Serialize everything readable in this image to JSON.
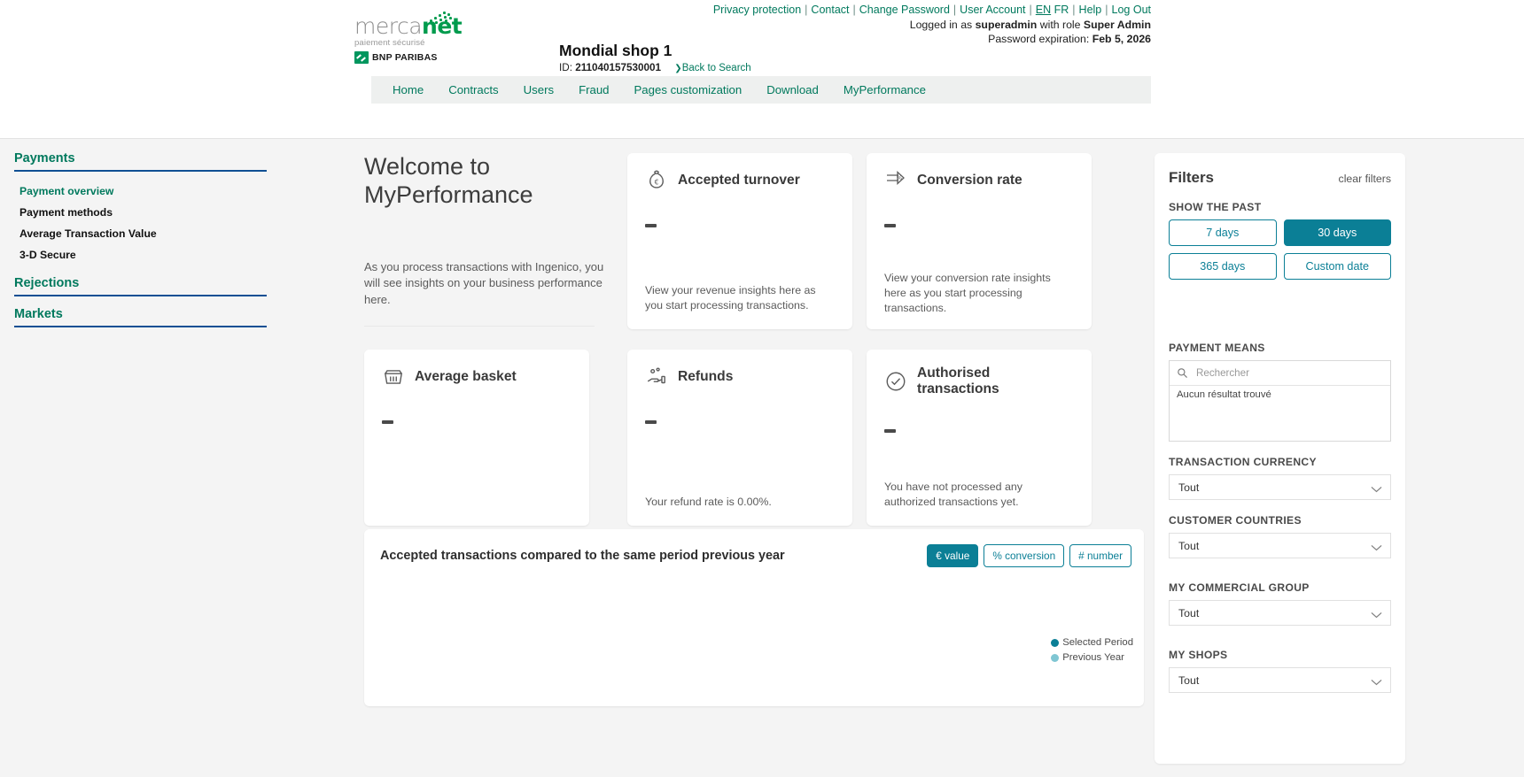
{
  "header": {
    "util_links": [
      "Privacy protection",
      "Contact",
      "Change Password",
      "User Account"
    ],
    "lang_en": "EN",
    "lang_fr": "FR",
    "help": "Help",
    "logout": "Log Out",
    "logged_in_prefix": "Logged in as ",
    "username": "superadmin",
    "role_prefix": " with role ",
    "role": "Super Admin",
    "password_expiration_label": "Password expiration: ",
    "password_expiration_value": "Feb 5, 2026",
    "logo_word_1": "merca",
    "logo_word_2": "net",
    "logo_tagline": "paiement sécurisé",
    "bank": "BNP PARIBAS",
    "shop_title": "Mondial shop 1",
    "shop_id_label": "ID: ",
    "shop_id_value": "211040157530001",
    "back_to_search": "Back to Search"
  },
  "nav": {
    "items": [
      "Home",
      "Contracts",
      "Users",
      "Fraud",
      "Pages customization",
      "Download",
      "MyPerformance"
    ]
  },
  "sidebar": {
    "groups": [
      {
        "title": "Payments",
        "items": [
          "Payment overview",
          "Payment methods",
          "Average Transaction Value",
          "3-D Secure"
        ]
      },
      {
        "title": "Rejections",
        "items": []
      },
      {
        "title": "Markets",
        "items": []
      }
    ]
  },
  "welcome": {
    "title_line1": "Welcome to",
    "title_line2": "MyPerformance",
    "body": "As you process transactions with Ingenico, you will see insights on your business performance here."
  },
  "kpis": [
    {
      "icon": "money-bag-icon",
      "title": "Accepted turnover",
      "value": "–",
      "note": "View your revenue insights here as you start processing transactions."
    },
    {
      "icon": "conversion-arrow-icon",
      "title": "Conversion rate",
      "value": "–",
      "note": "View your conversion rate insights here as you start processing transactions."
    },
    {
      "icon": "basket-icon",
      "title": "Average basket",
      "value": "–",
      "note": ""
    },
    {
      "icon": "refund-hand-icon",
      "title": "Refunds",
      "value": "–",
      "note": "Your refund rate is 0.00%."
    },
    {
      "icon": "check-circle-icon",
      "title": "Authorised transactions",
      "value": "–",
      "note": "You have not processed any authorized transactions yet."
    }
  ],
  "chart_card": {
    "title": "Accepted transactions compared to the same period previous year",
    "toggles": [
      {
        "label": "€ value",
        "active": true
      },
      {
        "label": "% conversion",
        "active": false
      },
      {
        "label": "# number",
        "active": false
      }
    ]
  },
  "chart_data": {
    "type": "bar",
    "title": "Accepted transactions compared to the same period previous year",
    "categories": [],
    "series": [
      {
        "name": "Selected Period",
        "values": [],
        "color": "#0b7f96"
      },
      {
        "name": "Previous Year",
        "values": [],
        "color": "#7fc6d3"
      }
    ],
    "xlabel": "",
    "ylabel": "",
    "legend_position": "bottom-right",
    "grid": false,
    "note": "No data plotted — chart area is empty"
  },
  "filters": {
    "title": "Filters",
    "clear": "clear filters",
    "show_past_label": "SHOW THE PAST",
    "range_buttons": [
      {
        "label": "7 days",
        "active": false
      },
      {
        "label": "30 days",
        "active": true
      },
      {
        "label": "365 days",
        "active": false
      },
      {
        "label": "Custom date",
        "active": false
      }
    ],
    "payment_means_label": "PAYMENT MEANS",
    "search_placeholder": "Rechercher",
    "search_value": "",
    "no_result": "Aucun résultat trouvé",
    "selects": [
      {
        "label": "TRANSACTION CURRENCY",
        "value": "Tout"
      },
      {
        "label": "CUSTOMER COUNTRIES",
        "value": "Tout"
      },
      {
        "label": "MY COMMERCIAL GROUP",
        "value": "Tout"
      },
      {
        "label": "MY SHOPS",
        "value": "Tout"
      }
    ]
  },
  "colors": {
    "brand_green": "#00795d",
    "accent_teal": "#0b7f96",
    "accent_teal_light": "#7fc6d3",
    "page_bg": "#f4f4f4",
    "nav_bg": "#eef0ef"
  }
}
